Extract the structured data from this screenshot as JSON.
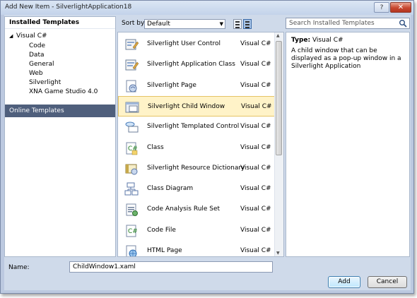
{
  "window": {
    "title": "Add New Item - SilverlightApplication18"
  },
  "titlebar": {
    "help_glyph": "?",
    "close_glyph": "✕"
  },
  "left": {
    "header": "Installed Templates",
    "root": "Visual C#",
    "children": [
      "Code",
      "Data",
      "General",
      "Web",
      "Silverlight",
      "XNA Game Studio 4.0"
    ],
    "online": "Online Templates"
  },
  "sort": {
    "label": "Sort by:",
    "value": "Default"
  },
  "templates": [
    {
      "name": "Silverlight User Control",
      "lang": "Visual C#",
      "icon": "silverlight-user-control-icon"
    },
    {
      "name": "Silverlight Application Class",
      "lang": "Visual C#",
      "icon": "silverlight-application-class-icon"
    },
    {
      "name": "Silverlight Page",
      "lang": "Visual C#",
      "icon": "silverlight-page-icon"
    },
    {
      "name": "Silverlight Child Window",
      "lang": "Visual C#",
      "icon": "silverlight-child-window-icon",
      "selected": true
    },
    {
      "name": "Silverlight Templated Control",
      "lang": "Visual C#",
      "icon": "silverlight-templated-control-icon"
    },
    {
      "name": "Class",
      "lang": "Visual C#",
      "icon": "class-icon"
    },
    {
      "name": "Silverlight Resource Dictionary",
      "lang": "Visual C#",
      "icon": "resource-dictionary-icon"
    },
    {
      "name": "Class Diagram",
      "lang": "Visual C#",
      "icon": "class-diagram-icon"
    },
    {
      "name": "Code Analysis Rule Set",
      "lang": "Visual C#",
      "icon": "code-analysis-rule-set-icon"
    },
    {
      "name": "Code File",
      "lang": "Visual C#",
      "icon": "code-file-icon"
    },
    {
      "name": "HTML Page",
      "lang": "Visual C#",
      "icon": "html-page-icon"
    }
  ],
  "search": {
    "placeholder": "Search Installed Templates"
  },
  "info": {
    "type_label": "Type:",
    "type_value": "Visual C#",
    "description": "A child window that can be displayed as a pop-up window in a Silverlight Application"
  },
  "bottom": {
    "name_label": "Name:",
    "name_value": "ChildWindow1.xaml",
    "add_label": "Add",
    "cancel_label": "Cancel"
  },
  "colors": {
    "selected_row_bg": "#fff3c8",
    "online_templates_bg": "#4f5f7c",
    "dialog_bg": "#cfdaea"
  }
}
